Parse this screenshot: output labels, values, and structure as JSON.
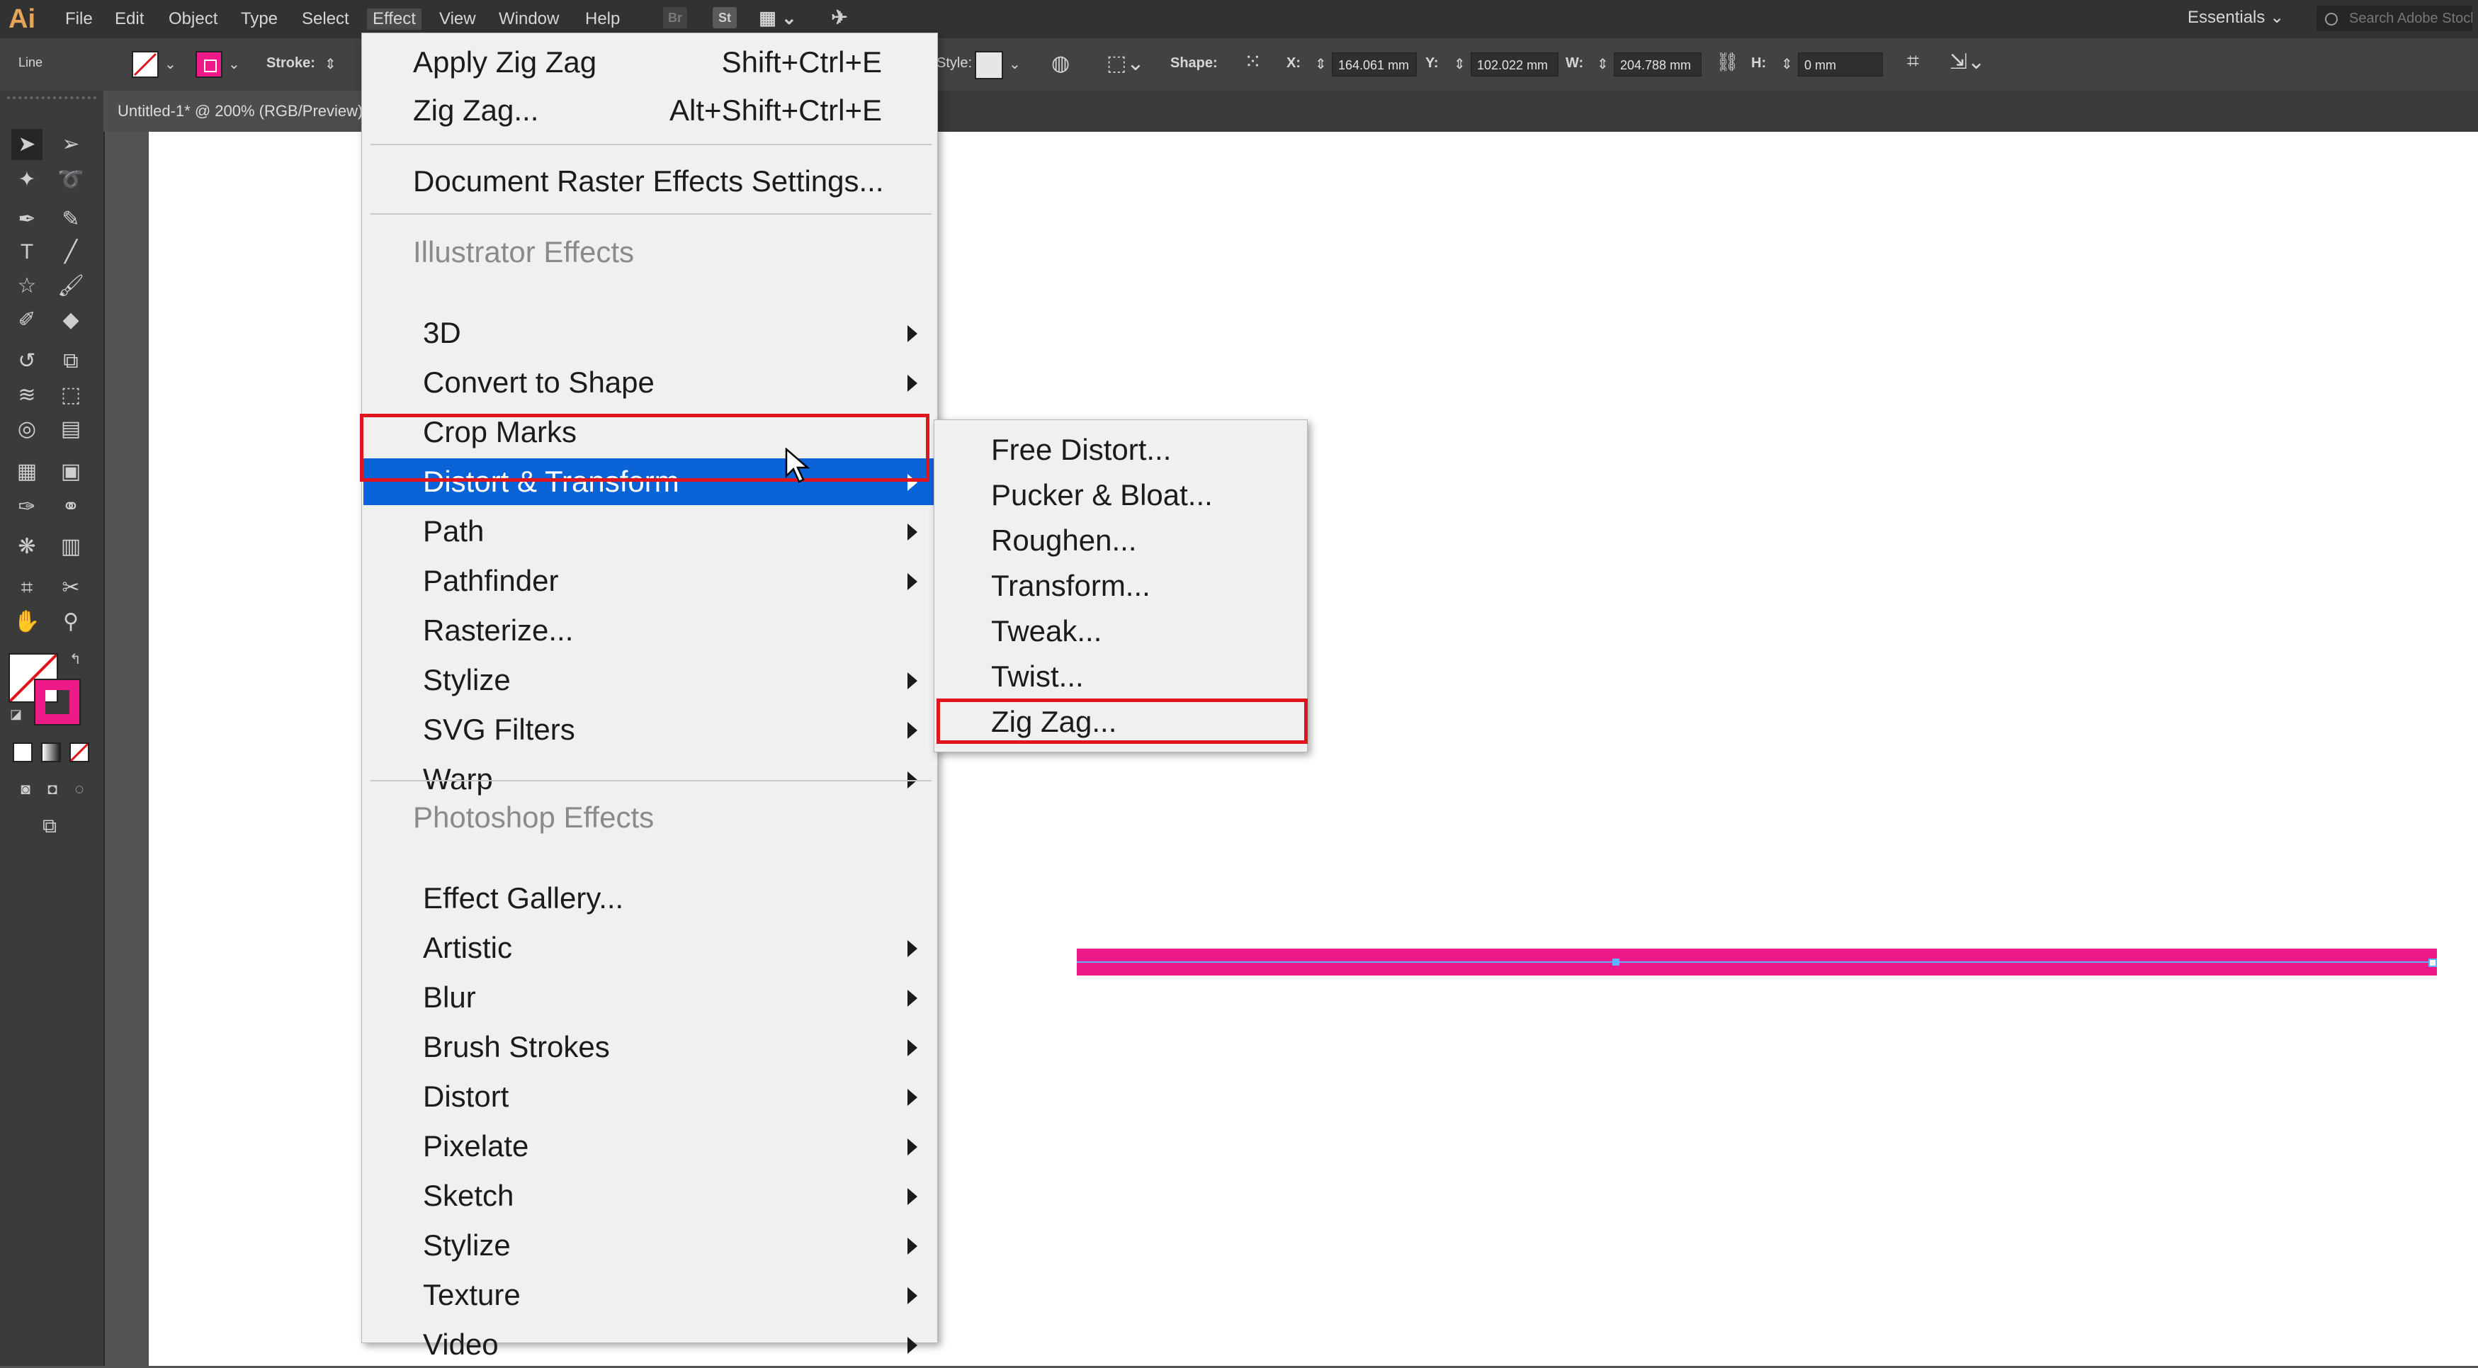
{
  "app": {
    "logo": "Ai"
  },
  "menubar": {
    "items": [
      "File",
      "Edit",
      "Object",
      "Type",
      "Select",
      "Effect",
      "View",
      "Window",
      "Help"
    ],
    "active": "Effect",
    "icons": {
      "bridge": "Br",
      "stock": "St"
    },
    "workspace": "Essentials",
    "search_placeholder": "Search Adobe Stock"
  },
  "controlbar": {
    "selection_type": "Line",
    "stroke_label": "Stroke:",
    "style_label": "Style:",
    "shape_label": "Shape:",
    "x_label": "X:",
    "x_value": "164.061 mm",
    "y_label": "Y:",
    "y_value": "102.022 mm",
    "w_label": "W:",
    "w_value": "204.788 mm",
    "h_label": "H:",
    "h_value": "0 mm"
  },
  "document": {
    "tab_title": "Untitled-1* @ 200% (RGB/Preview)"
  },
  "colors": {
    "stroke_color": "#ee1a8a",
    "highlight": "#0a64d8",
    "callout": "#e0141c"
  },
  "effect_menu": {
    "apply_last": {
      "label": "Apply Zig Zag",
      "shortcut": "Shift+Ctrl+E"
    },
    "last_dialog": {
      "label": "Zig Zag...",
      "shortcut": "Alt+Shift+Ctrl+E"
    },
    "doc_raster": "Document Raster Effects Settings...",
    "illustrator_header": "Illustrator Effects",
    "illustrator_items": [
      {
        "label": "3D",
        "submenu": true
      },
      {
        "label": "Convert to Shape",
        "submenu": true
      },
      {
        "label": "Crop Marks",
        "submenu": false
      },
      {
        "label": "Distort & Transform",
        "submenu": true,
        "highlighted": true
      },
      {
        "label": "Path",
        "submenu": true
      },
      {
        "label": "Pathfinder",
        "submenu": true
      },
      {
        "label": "Rasterize...",
        "submenu": false
      },
      {
        "label": "Stylize",
        "submenu": true
      },
      {
        "label": "SVG Filters",
        "submenu": true
      },
      {
        "label": "Warp",
        "submenu": true
      }
    ],
    "photoshop_header": "Photoshop Effects",
    "photoshop_items": [
      {
        "label": "Effect Gallery...",
        "submenu": false
      },
      {
        "label": "Artistic",
        "submenu": true
      },
      {
        "label": "Blur",
        "submenu": true
      },
      {
        "label": "Brush Strokes",
        "submenu": true
      },
      {
        "label": "Distort",
        "submenu": true
      },
      {
        "label": "Pixelate",
        "submenu": true
      },
      {
        "label": "Sketch",
        "submenu": true
      },
      {
        "label": "Stylize",
        "submenu": true
      },
      {
        "label": "Texture",
        "submenu": true
      },
      {
        "label": "Video",
        "submenu": true
      }
    ]
  },
  "distort_submenu": {
    "items": [
      "Free Distort...",
      "Pucker & Bloat...",
      "Roughen...",
      "Transform...",
      "Tweak...",
      "Twist...",
      "Zig Zag..."
    ],
    "callout_item": "Zig Zag..."
  }
}
